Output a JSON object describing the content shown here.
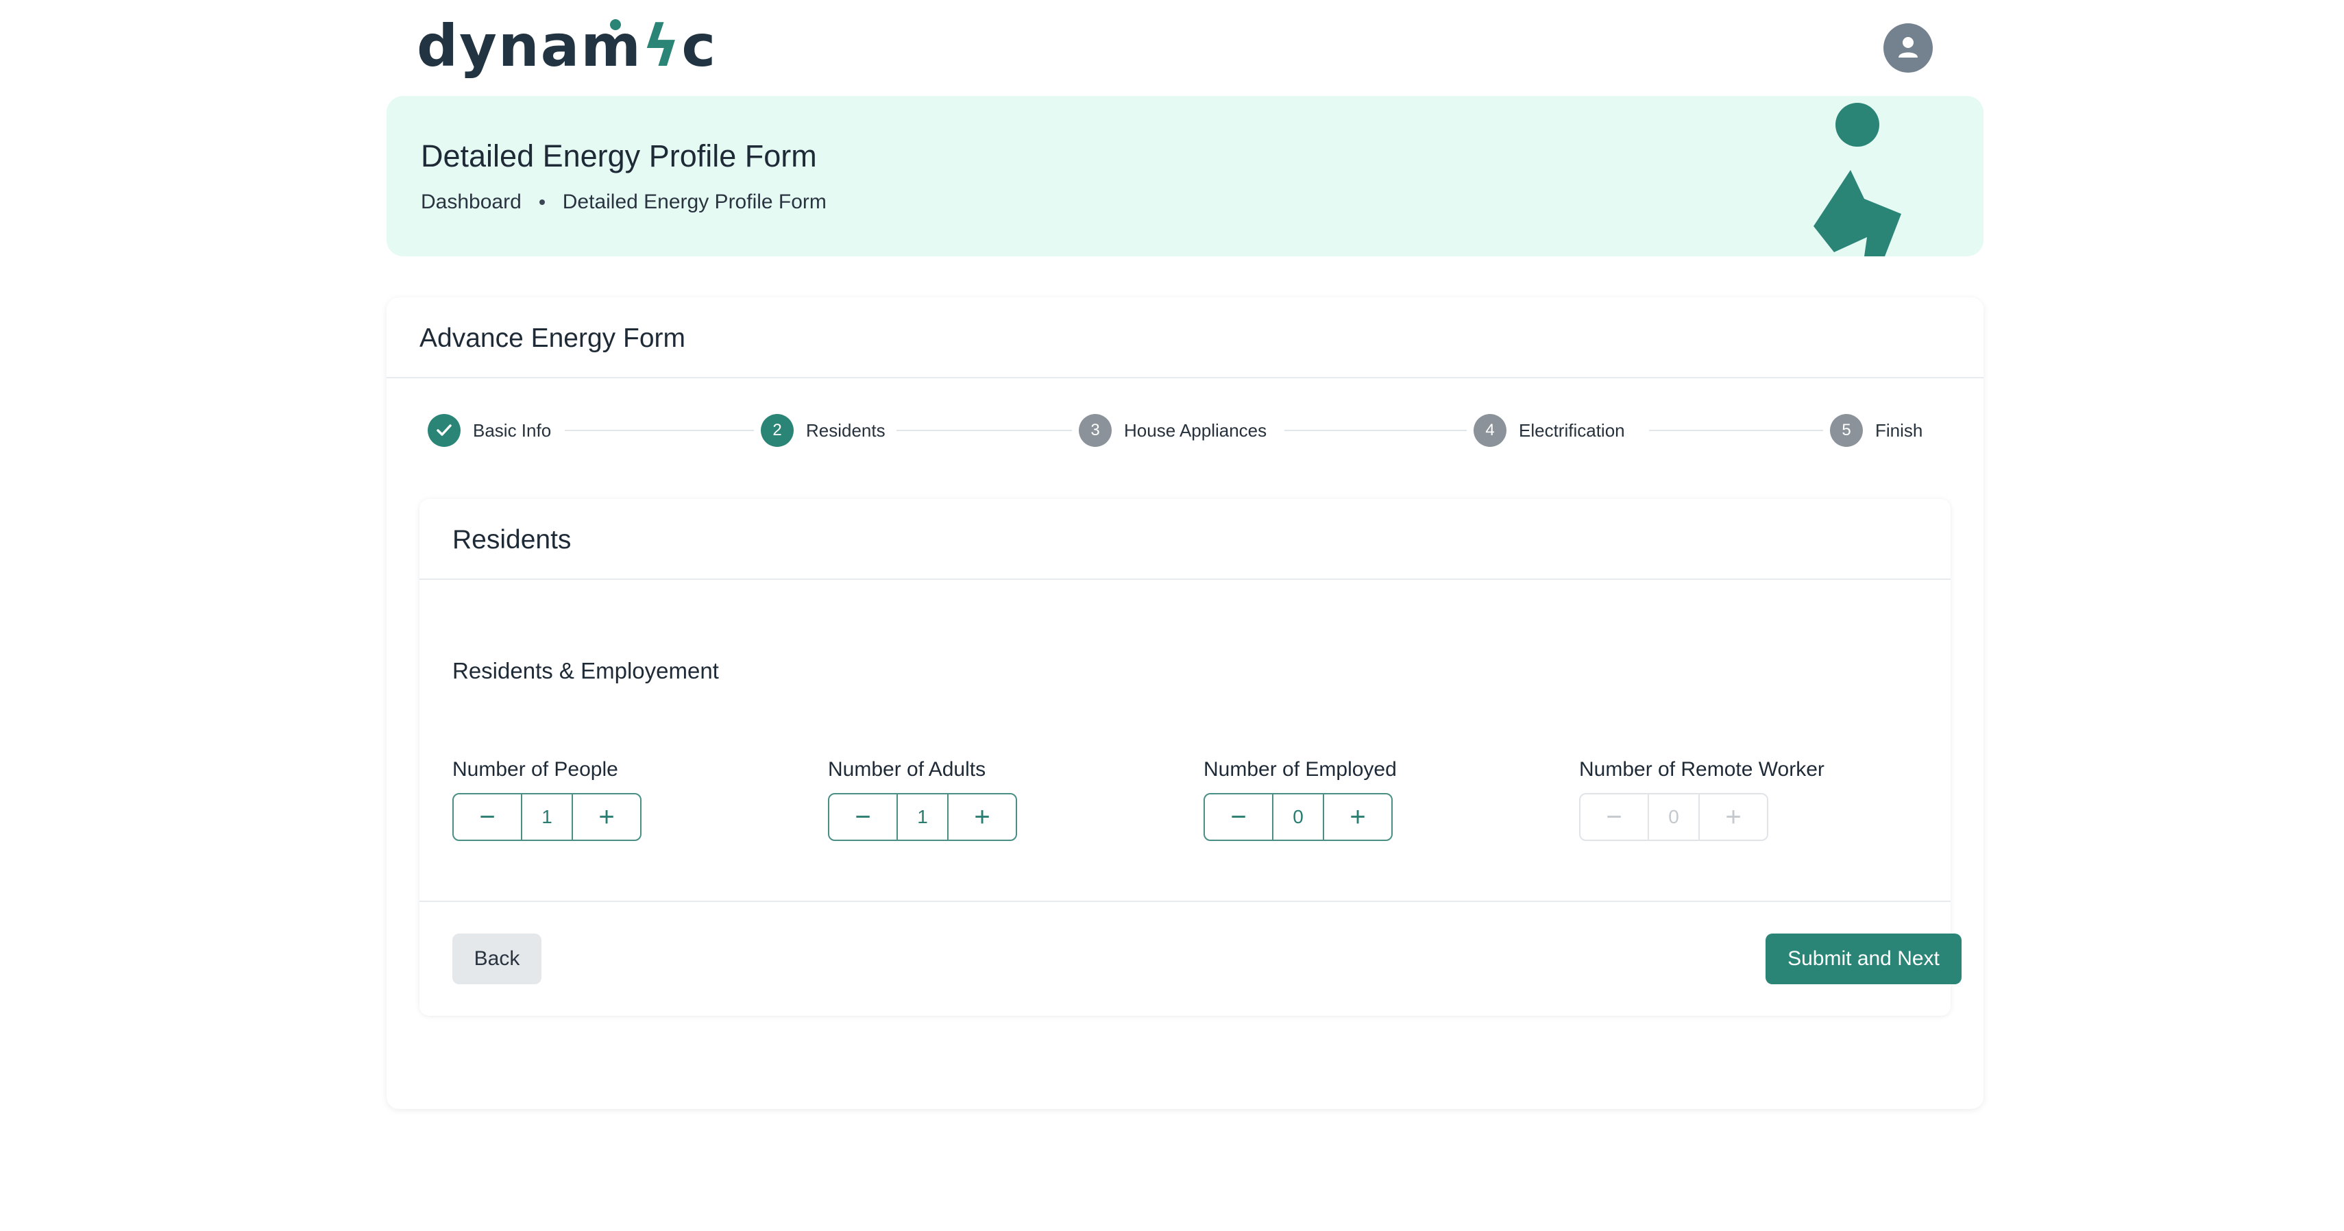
{
  "header": {
    "logo_text_a": "dynam",
    "logo_text_b": "c",
    "logo_mark": "bolt-i",
    "avatar_icon": "user-icon"
  },
  "hero": {
    "title": "Detailed Energy Profile Form",
    "breadcrumb": [
      "Dashboard",
      "Detailed Energy Profile Form"
    ]
  },
  "form_card": {
    "title": "Advance Energy Form",
    "steps": [
      {
        "number": "1",
        "label": "Basic Info",
        "status": "complete"
      },
      {
        "number": "2",
        "label": "Residents",
        "status": "active"
      },
      {
        "number": "3",
        "label": "House Appliances",
        "status": "pending"
      },
      {
        "number": "4",
        "label": "Electrification",
        "status": "pending"
      },
      {
        "number": "5",
        "label": "Finish",
        "status": "pending"
      }
    ]
  },
  "residents": {
    "title": "Residents",
    "section_title": "Residents & Employement",
    "fields": [
      {
        "label": "Number of People",
        "value": "1",
        "disabled": false
      },
      {
        "label": "Number of Adults",
        "value": "1",
        "disabled": false
      },
      {
        "label": "Number of Employed",
        "value": "0",
        "disabled": false
      },
      {
        "label": "Number of Remote Worker",
        "value": "0",
        "disabled": true
      }
    ],
    "decrement_symbol": "−",
    "increment_symbol": "+"
  },
  "actions": {
    "back_label": "Back",
    "submit_label": "Submit and Next"
  },
  "colors": {
    "brand": "#2a8577",
    "hero_bg": "#e6faf4",
    "pending_step": "#8b9299",
    "text_dark": "#1f2a37"
  }
}
